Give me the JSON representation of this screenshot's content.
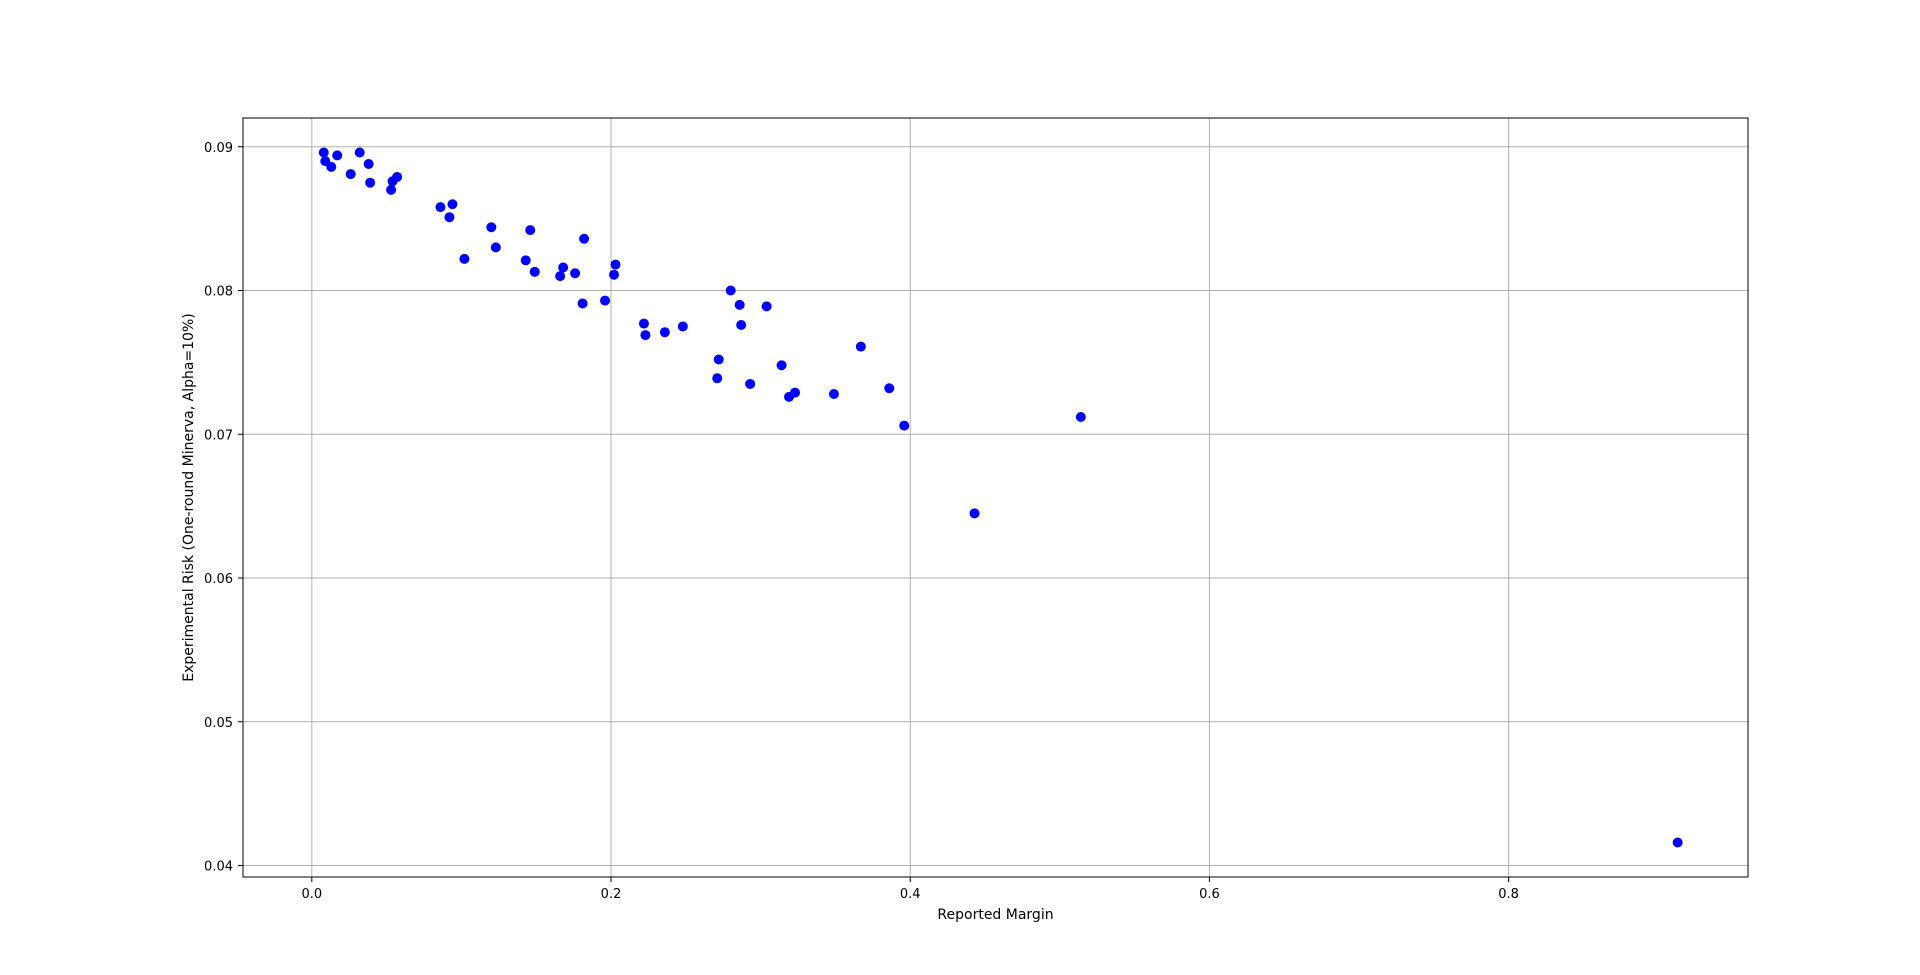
{
  "chart_data": {
    "type": "scatter",
    "title": "",
    "xlabel": "Reported Margin",
    "ylabel": "Experimental Risk (One-round Minerva, Alpha=10%)",
    "xlim": [
      -0.046,
      0.96
    ],
    "ylim": [
      0.0392,
      0.092
    ],
    "xticks": [
      0.0,
      0.2,
      0.4,
      0.6,
      0.8
    ],
    "xtick_labels": [
      "0.0",
      "0.2",
      "0.4",
      "0.6",
      "0.8"
    ],
    "yticks": [
      0.04,
      0.05,
      0.06,
      0.07,
      0.08,
      0.09
    ],
    "ytick_labels": [
      "0.04",
      "0.05",
      "0.06",
      "0.07",
      "0.08",
      "0.09"
    ],
    "grid": true,
    "marker_color": "#0000ff",
    "series": [
      {
        "x": [
          0.008,
          0.009,
          0.013,
          0.017,
          0.026,
          0.032,
          0.038,
          0.039,
          0.053,
          0.054,
          0.057,
          0.086,
          0.092,
          0.094,
          0.102,
          0.12,
          0.123,
          0.143,
          0.146,
          0.149,
          0.166,
          0.168,
          0.176,
          0.181,
          0.182,
          0.196,
          0.202,
          0.203,
          0.222,
          0.223,
          0.236,
          0.248,
          0.271,
          0.272,
          0.28,
          0.286,
          0.287,
          0.293,
          0.304,
          0.314,
          0.319,
          0.323,
          0.349,
          0.367,
          0.386,
          0.396,
          0.443,
          0.514,
          0.913
        ],
        "y": [
          0.0896,
          0.089,
          0.0886,
          0.0894,
          0.0881,
          0.0896,
          0.0888,
          0.0875,
          0.087,
          0.0876,
          0.0879,
          0.0858,
          0.0851,
          0.086,
          0.0822,
          0.0844,
          0.083,
          0.0821,
          0.0842,
          0.0813,
          0.081,
          0.0816,
          0.0812,
          0.0791,
          0.0836,
          0.0793,
          0.0811,
          0.0818,
          0.0777,
          0.0769,
          0.0771,
          0.0775,
          0.0739,
          0.0752,
          0.08,
          0.079,
          0.0776,
          0.0735,
          0.0789,
          0.0748,
          0.0726,
          0.0729,
          0.0728,
          0.0761,
          0.0732,
          0.0706,
          0.0645,
          0.0712,
          0.0416
        ]
      }
    ]
  }
}
